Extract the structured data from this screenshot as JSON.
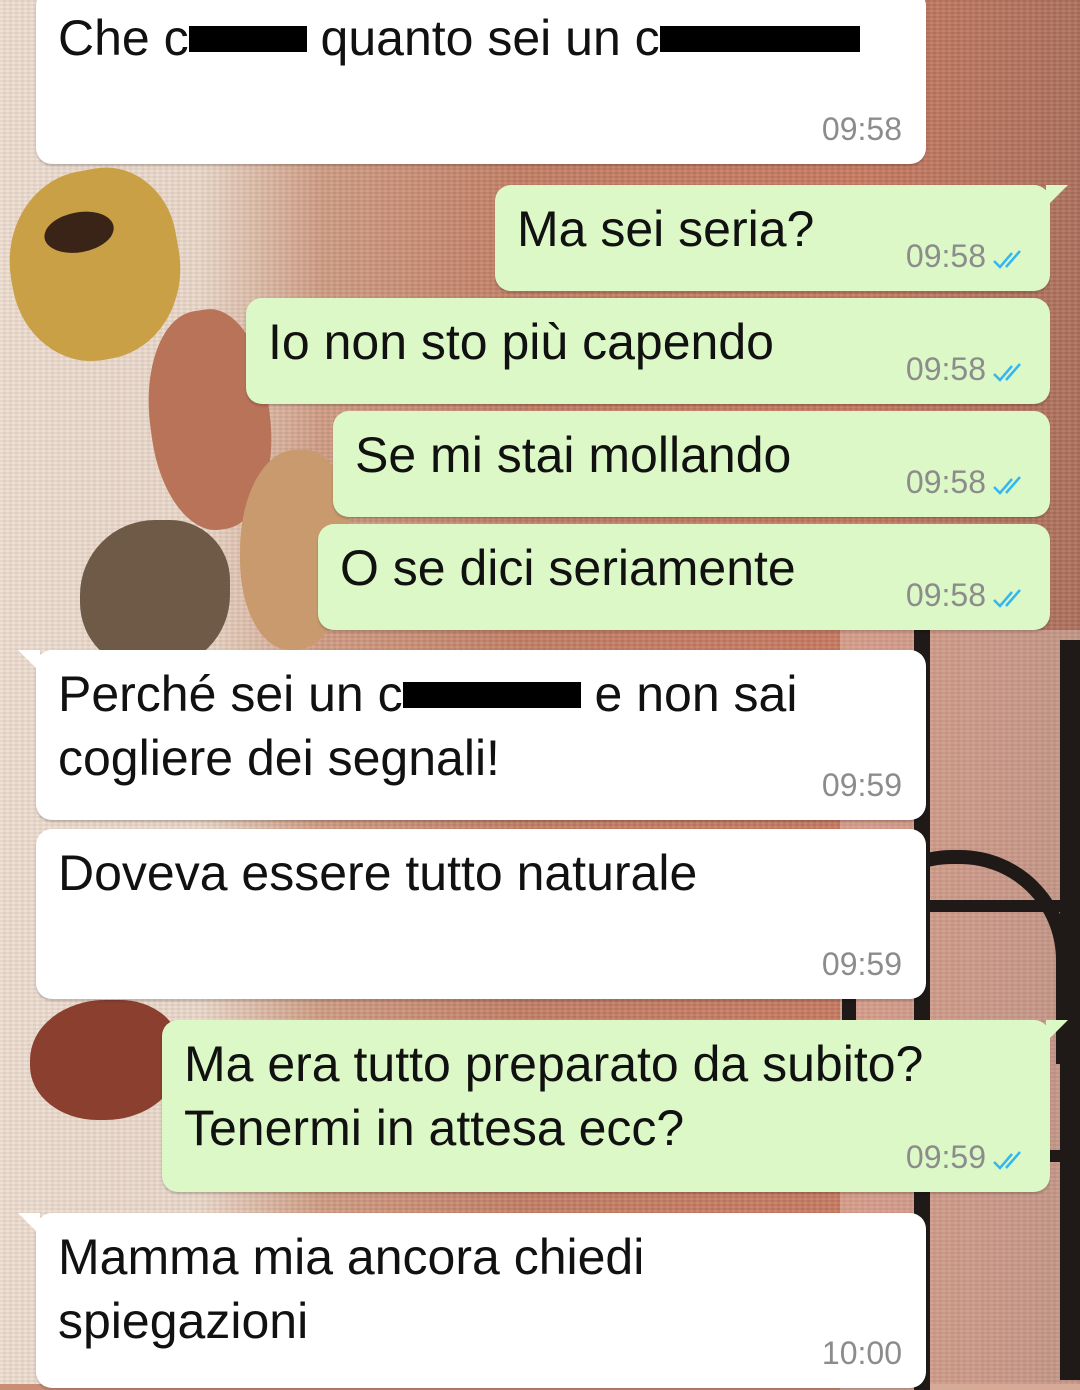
{
  "messages": [
    {
      "direction": "incoming",
      "text_parts": [
        "Che c",
        "",
        " quanto sei un c",
        ""
      ],
      "time": "09:58"
    },
    {
      "direction": "outgoing",
      "text": "Ma sei seria?",
      "time": "09:58",
      "status": "read"
    },
    {
      "direction": "outgoing",
      "text": "Io non sto più capendo",
      "time": "09:58",
      "status": "read"
    },
    {
      "direction": "outgoing",
      "text": "Se mi stai mollando",
      "time": "09:58",
      "status": "read"
    },
    {
      "direction": "outgoing",
      "text": "O se dici seriamente",
      "time": "09:58",
      "status": "read"
    },
    {
      "direction": "incoming",
      "line1_parts": [
        "Perché sei un c",
        "",
        " e non sai"
      ],
      "line2": "cogliere dei segnali!",
      "time": "09:59"
    },
    {
      "direction": "incoming",
      "text": "Doveva essere tutto naturale",
      "time": "09:59"
    },
    {
      "direction": "outgoing",
      "line1": "Ma era tutto preparato da subito?",
      "line2": "Tenermi in attesa ecc?",
      "time": "09:59",
      "status": "read"
    },
    {
      "direction": "incoming",
      "line1": "Mamma mia ancora chiedi",
      "line2": "spiegazioni",
      "time": "10:00"
    }
  ],
  "colors": {
    "incoming_bubble": "#ffffff",
    "outgoing_bubble": "#dcf8c6",
    "read_check": "#34b7f1",
    "time_text": "#8c8c8c"
  },
  "icons": {
    "read_status": "double-check-icon"
  }
}
